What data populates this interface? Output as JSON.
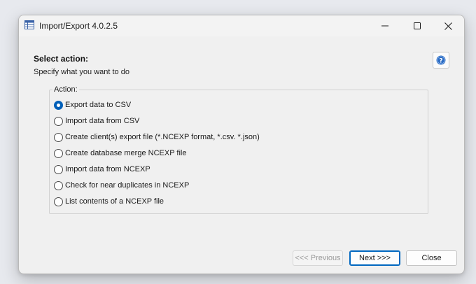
{
  "window": {
    "title": "Import/Export 4.0.2.5"
  },
  "header": {
    "heading": "Select action:",
    "subheading": "Specify what you want to do"
  },
  "action_group": {
    "label": "Action:",
    "options": [
      {
        "label": "Export data to CSV",
        "checked": true
      },
      {
        "label": "Import data from CSV",
        "checked": false
      },
      {
        "label": "Create client(s) export file (*.NCEXP format, *.csv. *.json)",
        "checked": false
      },
      {
        "label": "Create database merge NCEXP file",
        "checked": false
      },
      {
        "label": "Import data from NCEXP",
        "checked": false
      },
      {
        "label": "Check for near duplicates in NCEXP",
        "checked": false
      },
      {
        "label": "List contents of a NCEXP file",
        "checked": false
      }
    ]
  },
  "buttons": {
    "previous": "<<< Previous",
    "next": "Next >>>",
    "close": "Close"
  },
  "icons": {
    "app": "table-icon",
    "help": "help-icon",
    "minimize": "minimize-icon",
    "maximize": "maximize-icon",
    "close": "close-icon"
  },
  "colors": {
    "accent": "#005fb8",
    "help_icon": "#2b6cc4"
  }
}
